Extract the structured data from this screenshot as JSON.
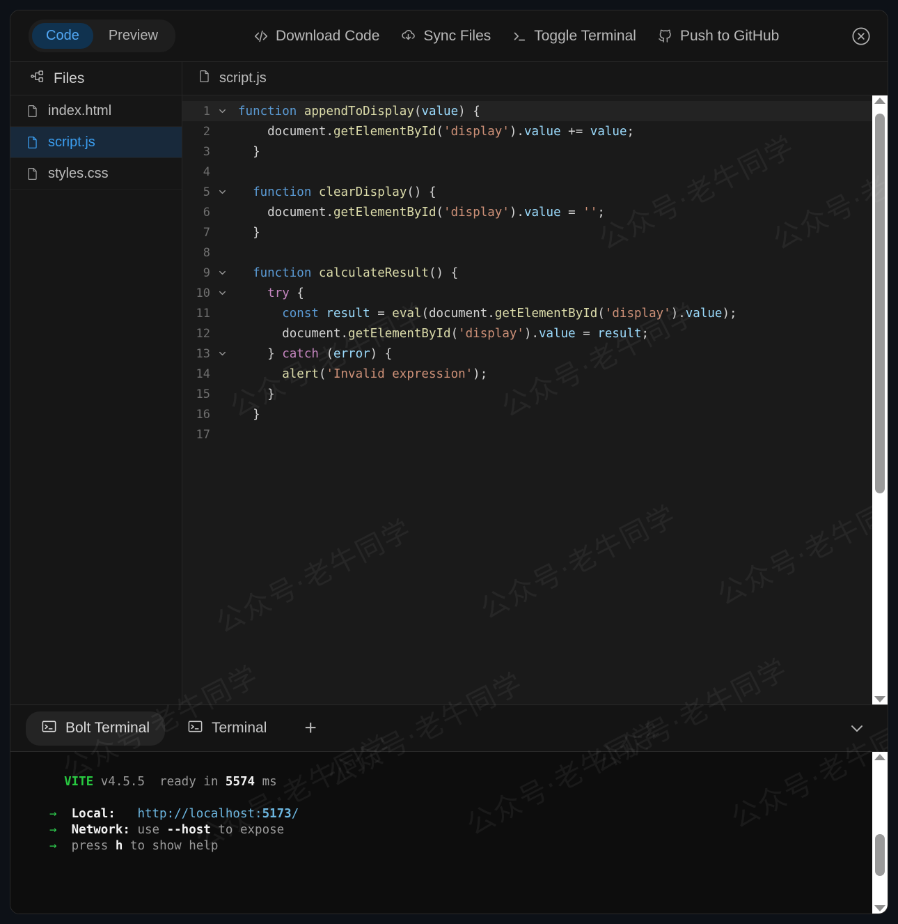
{
  "toolbar": {
    "segmented": {
      "options": [
        "Code",
        "Preview"
      ],
      "selected": "Code"
    },
    "actions": [
      {
        "label": "Download Code",
        "icon": "code-brackets-icon"
      },
      {
        "label": "Sync Files",
        "icon": "cloud-sync-icon"
      },
      {
        "label": "Toggle Terminal",
        "icon": "terminal-prompt-icon"
      },
      {
        "label": "Push to GitHub",
        "icon": "github-icon"
      }
    ],
    "close_label": "×"
  },
  "sidebar": {
    "header": {
      "label": "Files",
      "icon": "file-tree-icon"
    },
    "items": [
      {
        "label": "index.html",
        "selected": false
      },
      {
        "label": "script.js",
        "selected": true
      },
      {
        "label": "styles.css",
        "selected": false
      }
    ]
  },
  "editor": {
    "tab": {
      "label": "script.js",
      "icon": "file-icon"
    },
    "active_line": 1,
    "fold_lines": [
      1,
      5,
      9,
      10,
      13
    ],
    "lines": [
      {
        "n": 1,
        "tokens": [
          {
            "t": "function",
            "c": "kw"
          },
          {
            "t": " ",
            "c": "pl"
          },
          {
            "t": "appendToDisplay",
            "c": "fn"
          },
          {
            "t": "(",
            "c": "pl"
          },
          {
            "t": "value",
            "c": "var"
          },
          {
            "t": ") {",
            "c": "pl"
          }
        ]
      },
      {
        "n": 2,
        "tokens": [
          {
            "t": "    document",
            "c": "pl"
          },
          {
            "t": ".",
            "c": "pl"
          },
          {
            "t": "getElementById",
            "c": "fn"
          },
          {
            "t": "(",
            "c": "pl"
          },
          {
            "t": "'display'",
            "c": "str"
          },
          {
            "t": ").",
            "c": "pl"
          },
          {
            "t": "value",
            "c": "var"
          },
          {
            "t": " += ",
            "c": "op"
          },
          {
            "t": "value",
            "c": "var"
          },
          {
            "t": ";",
            "c": "pl"
          }
        ]
      },
      {
        "n": 3,
        "tokens": [
          {
            "t": "  }",
            "c": "pl"
          }
        ]
      },
      {
        "n": 4,
        "tokens": []
      },
      {
        "n": 5,
        "tokens": [
          {
            "t": "  ",
            "c": "pl"
          },
          {
            "t": "function",
            "c": "kw"
          },
          {
            "t": " ",
            "c": "pl"
          },
          {
            "t": "clearDisplay",
            "c": "fn"
          },
          {
            "t": "() {",
            "c": "pl"
          }
        ]
      },
      {
        "n": 6,
        "tokens": [
          {
            "t": "    document",
            "c": "pl"
          },
          {
            "t": ".",
            "c": "pl"
          },
          {
            "t": "getElementById",
            "c": "fn"
          },
          {
            "t": "(",
            "c": "pl"
          },
          {
            "t": "'display'",
            "c": "str"
          },
          {
            "t": ").",
            "c": "pl"
          },
          {
            "t": "value",
            "c": "var"
          },
          {
            "t": " = ",
            "c": "op"
          },
          {
            "t": "''",
            "c": "str"
          },
          {
            "t": ";",
            "c": "pl"
          }
        ]
      },
      {
        "n": 7,
        "tokens": [
          {
            "t": "  }",
            "c": "pl"
          }
        ]
      },
      {
        "n": 8,
        "tokens": []
      },
      {
        "n": 9,
        "tokens": [
          {
            "t": "  ",
            "c": "pl"
          },
          {
            "t": "function",
            "c": "kw"
          },
          {
            "t": " ",
            "c": "pl"
          },
          {
            "t": "calculateResult",
            "c": "fn"
          },
          {
            "t": "() {",
            "c": "pl"
          }
        ]
      },
      {
        "n": 10,
        "tokens": [
          {
            "t": "    ",
            "c": "pl"
          },
          {
            "t": "try",
            "c": "kw2"
          },
          {
            "t": " {",
            "c": "pl"
          }
        ]
      },
      {
        "n": 11,
        "tokens": [
          {
            "t": "      ",
            "c": "pl"
          },
          {
            "t": "const",
            "c": "kw"
          },
          {
            "t": " ",
            "c": "pl"
          },
          {
            "t": "result",
            "c": "var"
          },
          {
            "t": " = ",
            "c": "op"
          },
          {
            "t": "eval",
            "c": "fn"
          },
          {
            "t": "(document.",
            "c": "pl"
          },
          {
            "t": "getElementById",
            "c": "fn"
          },
          {
            "t": "(",
            "c": "pl"
          },
          {
            "t": "'display'",
            "c": "str"
          },
          {
            "t": ").",
            "c": "pl"
          },
          {
            "t": "value",
            "c": "var"
          },
          {
            "t": ");",
            "c": "pl"
          }
        ]
      },
      {
        "n": 12,
        "tokens": [
          {
            "t": "      document.",
            "c": "pl"
          },
          {
            "t": "getElementById",
            "c": "fn"
          },
          {
            "t": "(",
            "c": "pl"
          },
          {
            "t": "'display'",
            "c": "str"
          },
          {
            "t": ").",
            "c": "pl"
          },
          {
            "t": "value",
            "c": "var"
          },
          {
            "t": " = ",
            "c": "op"
          },
          {
            "t": "result",
            "c": "var"
          },
          {
            "t": ";",
            "c": "pl"
          }
        ]
      },
      {
        "n": 13,
        "tokens": [
          {
            "t": "    } ",
            "c": "pl"
          },
          {
            "t": "catch",
            "c": "kw2"
          },
          {
            "t": " (",
            "c": "pl"
          },
          {
            "t": "error",
            "c": "var"
          },
          {
            "t": ") {",
            "c": "pl"
          }
        ]
      },
      {
        "n": 14,
        "tokens": [
          {
            "t": "      ",
            "c": "pl"
          },
          {
            "t": "alert",
            "c": "fn"
          },
          {
            "t": "(",
            "c": "pl"
          },
          {
            "t": "'Invalid expression'",
            "c": "str"
          },
          {
            "t": ");",
            "c": "pl"
          }
        ]
      },
      {
        "n": 15,
        "tokens": [
          {
            "t": "    }",
            "c": "pl"
          }
        ]
      },
      {
        "n": 16,
        "tokens": [
          {
            "t": "  }",
            "c": "pl"
          }
        ]
      },
      {
        "n": 17,
        "tokens": []
      }
    ]
  },
  "terminal": {
    "tabs": [
      {
        "label": "Bolt Terminal",
        "active": true,
        "icon": "terminal-icon"
      },
      {
        "label": "Terminal",
        "active": false,
        "icon": "terminal-icon"
      }
    ],
    "add_label": "+",
    "output": [
      {
        "segs": [
          {
            "t": "  ",
            "c": "dim"
          },
          {
            "t": "VITE",
            "c": "g"
          },
          {
            "t": " v4.5.5",
            "c": "dim"
          },
          {
            "t": "  ready in ",
            "c": "dim"
          },
          {
            "t": "5574",
            "c": "w"
          },
          {
            "t": " ms",
            "c": "dim"
          }
        ]
      },
      {
        "segs": []
      },
      {
        "segs": [
          {
            "t": "→",
            "c": "gd"
          },
          {
            "t": "  ",
            "c": "dim"
          },
          {
            "t": "Local:",
            "c": "w"
          },
          {
            "t": "   ",
            "c": "dim"
          },
          {
            "t": "http://localhost:",
            "c": "b"
          },
          {
            "t": "5173",
            "c": "bb"
          },
          {
            "t": "/",
            "c": "b"
          }
        ]
      },
      {
        "segs": [
          {
            "t": "→",
            "c": "gd"
          },
          {
            "t": "  ",
            "c": "dim"
          },
          {
            "t": "Network:",
            "c": "w"
          },
          {
            "t": " use ",
            "c": "dim"
          },
          {
            "t": "--host",
            "c": "w"
          },
          {
            "t": " to expose",
            "c": "dim"
          }
        ]
      },
      {
        "segs": [
          {
            "t": "→",
            "c": "gd"
          },
          {
            "t": "  ",
            "c": "dim"
          },
          {
            "t": "press ",
            "c": "dim"
          },
          {
            "t": "h",
            "c": "w"
          },
          {
            "t": " to show help",
            "c": "dim"
          }
        ]
      }
    ]
  },
  "watermark": {
    "text": "公众号·老牛同学"
  },
  "colors": {
    "accent": "#3b9ef0",
    "accent_bg": "#10324f",
    "panel": "#161616",
    "editor_bg": "#1a1a1a",
    "terminal_bg": "#0d0d0d",
    "terminal_green": "#28c940",
    "terminal_blue": "#6cb6e0"
  }
}
